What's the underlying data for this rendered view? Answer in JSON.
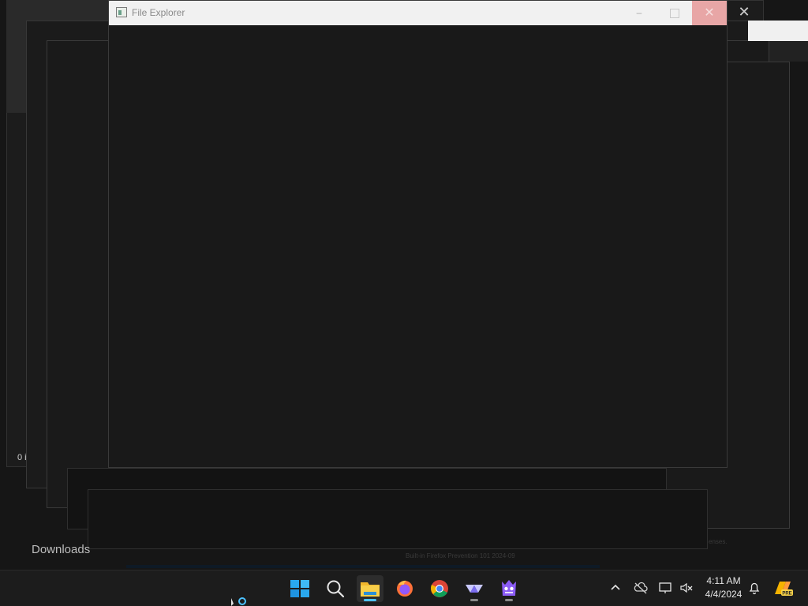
{
  "explorer_window": {
    "title": "File Explorer",
    "minimize_glyph": "–",
    "maximize_glyph": "",
    "close_glyph": "✕"
  },
  "background": {
    "status_text": "0 i",
    "downloads_label": "Downloads",
    "ghost_close_glyph": "✕",
    "faint_text_right": "enses.",
    "faint_text_bottom": "Built-in Firefox Prevention 101 2024-09"
  },
  "taskbar": {
    "items": [
      {
        "name": "start-button",
        "icon": "windows-logo-icon"
      },
      {
        "name": "search-button",
        "icon": "search-icon"
      },
      {
        "name": "file-explorer-button",
        "icon": "folder-icon",
        "active": true
      },
      {
        "name": "firefox-button",
        "icon": "firefox-icon"
      },
      {
        "name": "chrome-button",
        "icon": "chrome-icon"
      },
      {
        "name": "app-button",
        "icon": "triangle-app-icon"
      },
      {
        "name": "game-app-button",
        "icon": "monster-app-icon"
      }
    ],
    "tray": {
      "time": "4:11 AM",
      "date": "4/4/2024"
    }
  },
  "colors": {
    "accent": "#4cc2ff",
    "close_hover": "#e8a6a6",
    "titlebar": "#f1f1f1",
    "window_body": "#191919"
  }
}
